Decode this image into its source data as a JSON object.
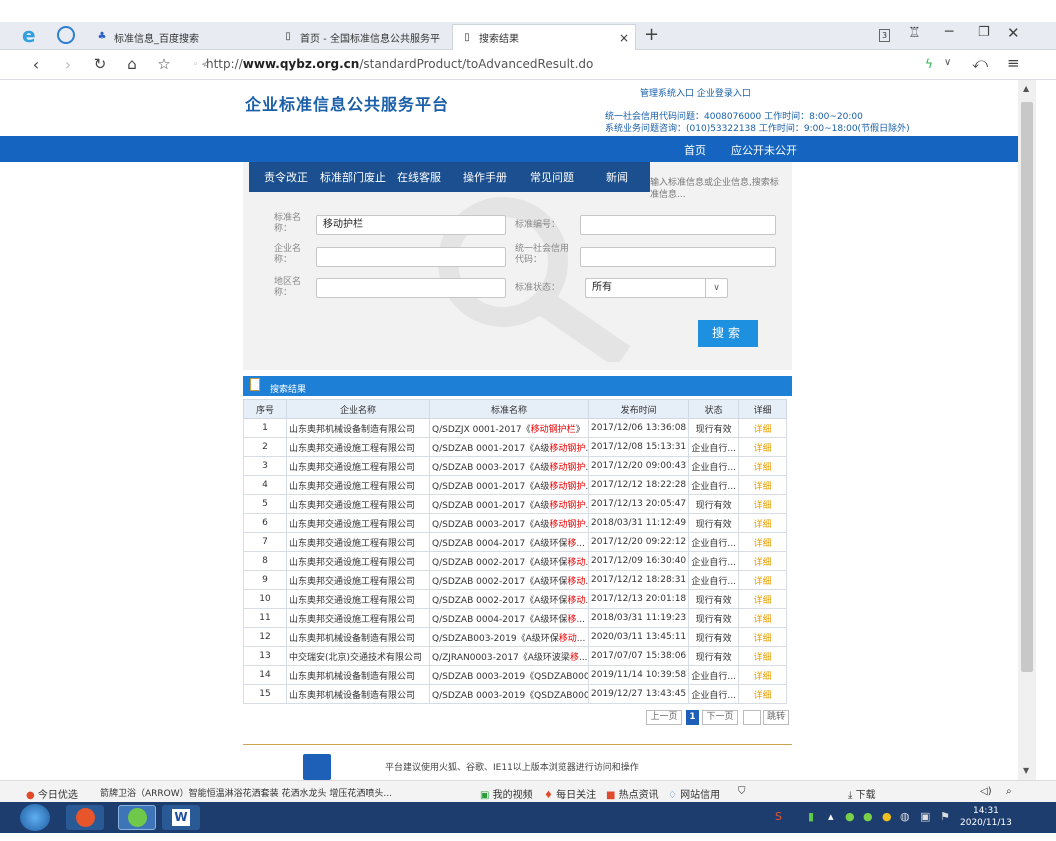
{
  "browser": {
    "tabs": [
      {
        "label": "标准信息_百度搜索"
      },
      {
        "label": "首页 - 全国标准信息公共服务平"
      },
      {
        "label": "搜索结果"
      }
    ],
    "new_tab": "+",
    "window_controls": [
      "S",
      "─",
      "❐",
      "✕"
    ],
    "url_prefix": "http://",
    "url_domain": "www.qybz.org.cn",
    "url_path": "/standardProduct/toAdvancedResult.do"
  },
  "header": {
    "site_title": "企业标准信息公共服务平台",
    "top_links": "管理系统入口  企业登录入口",
    "hotline_1": "统一社会信用代码问题：4008076000 工作时间：8:00~20:00",
    "hotline_2": "系统业务问题咨询：(010)53322138 工作时间：9:00~18:00(节假日除外)",
    "nav": [
      "首页",
      "应公开未公开"
    ]
  },
  "menu": [
    "责令改正",
    "标准部门废止",
    "在线客服",
    "操作手册",
    "常见问题",
    "新闻"
  ],
  "search_hint": "输入标准信息或企业信息,搜索标准信息...",
  "form": {
    "std_name_label": "标准名称：",
    "std_name_value": "移动护栏",
    "std_no_label": "标准编号：",
    "std_no_value": "",
    "company_label": "企业名称：",
    "company_value": "",
    "credit_label": "统一社会信用代码：",
    "credit_value": "",
    "region_label": "地区名称：",
    "region_value": "",
    "status_label": "标准状态：",
    "status_value": "所有",
    "status_arrow": "∨",
    "search_button": "搜索"
  },
  "results": {
    "title": "搜索结果",
    "columns": [
      "序号",
      "企业名称",
      "标准名称",
      "发布时间",
      "状态",
      "详细"
    ],
    "rows": [
      [
        "1",
        "山东奥邦机械设备制造有限公司",
        "Q/SDZJX 0001-2017《",
        "移动钢护栏",
        "》",
        "2017/12/06 13:36:08",
        "现行有效",
        "详细"
      ],
      [
        "2",
        "山东奥邦交通设施工程有限公司",
        "Q/SDZAB 0001-2017《A级",
        "移动钢护",
        "...",
        "2017/12/08 15:13:31",
        "企业自行...",
        "详细"
      ],
      [
        "3",
        "山东奥邦交通设施工程有限公司",
        "Q/SDZAB 0003-2017《A级",
        "移动钢护",
        "...",
        "2017/12/20 09:00:43",
        "企业自行...",
        "详细"
      ],
      [
        "4",
        "山东奥邦交通设施工程有限公司",
        "Q/SDZAB 0001-2017《A级",
        "移动钢护",
        "...",
        "2017/12/12 18:22:28",
        "企业自行...",
        "详细"
      ],
      [
        "5",
        "山东奥邦交通设施工程有限公司",
        "Q/SDZAB 0001-2017《A级",
        "移动钢护",
        "...",
        "2017/12/13 20:05:47",
        "现行有效",
        "详细"
      ],
      [
        "6",
        "山东奥邦交通设施工程有限公司",
        "Q/SDZAB 0003-2017《A级",
        "移动钢护",
        "...",
        "2018/03/31 11:12:49",
        "现行有效",
        "详细"
      ],
      [
        "7",
        "山东奥邦交通设施工程有限公司",
        "Q/SDZAB  0004-2017《A级环保",
        "移",
        "...",
        "2017/12/20 09:22:12",
        "企业自行...",
        "详细"
      ],
      [
        "8",
        "山东奥邦交通设施工程有限公司",
        "Q/SDZAB 0002-2017《A级环保",
        "移动",
        "...",
        "2017/12/09 16:30:40",
        "企业自行...",
        "详细"
      ],
      [
        "9",
        "山东奥邦交通设施工程有限公司",
        "Q/SDZAB 0002-2017《A级环保",
        "移动",
        "...",
        "2017/12/12 18:28:31",
        "企业自行...",
        "详细"
      ],
      [
        "10",
        "山东奥邦交通设施工程有限公司",
        "Q/SDZAB 0002-2017《A级环保",
        "移动",
        "...",
        "2017/12/13 20:01:18",
        "现行有效",
        "详细"
      ],
      [
        "11",
        "山东奥邦交通设施工程有限公司",
        "Q/SDZAB  0004-2017《A级环保",
        "移",
        "...",
        "2018/03/31 11:19:23",
        "现行有效",
        "详细"
      ],
      [
        "12",
        "山东奥邦机械设备制造有限公司",
        "Q/SDZAB003-2019《A级环保",
        "移动",
        "...",
        "2020/03/11 13:45:11",
        "现行有效",
        "详细"
      ],
      [
        "13",
        "中交瑞安(北京)交通技术有限公司",
        "Q/ZJRAN0003-2017《A级环波梁",
        "移",
        "...",
        "2017/07/07 15:38:06",
        "现行有效",
        "详细"
      ],
      [
        "14",
        "山东奥邦机械设备制造有限公司",
        "Q/SDZAB 0003-2019《QSDZAB000...",
        "",
        "",
        "2019/11/14 10:39:58",
        "企业自行...",
        "详细"
      ],
      [
        "15",
        "山东奥邦机械设备制造有限公司",
        "Q/SDZAB 0003-2019《QSDZAB000...",
        "",
        "",
        "2019/12/27 13:43:45",
        "企业自行...",
        "详细"
      ]
    ]
  },
  "pager": {
    "prev": "上一页",
    "current": "1",
    "next": "下一页",
    "goto": "跳转"
  },
  "footer": {
    "notice": "平台建议使用火狐、谷歌、IE11以上版本浏览器进行访问和操作"
  },
  "statusbar": {
    "today": "今日优选",
    "ad": "箭牌卫浴（ARROW）智能恒温淋浴花洒套装 花洒水龙头 增压花洒喷头...",
    "video": "我的视频",
    "follow": "每日关注",
    "news": "热点资讯",
    "net": "网站信用",
    "download": "下载"
  },
  "taskbar": {
    "time": "14:31",
    "date": "2020/11/13"
  },
  "colors": {
    "brand_blue": "#1565c0",
    "menu_blue": "#1b4f8f",
    "search_blue": "#1e90e0",
    "highlight_red": "#e00000",
    "detail_orange": "#e8a000"
  }
}
